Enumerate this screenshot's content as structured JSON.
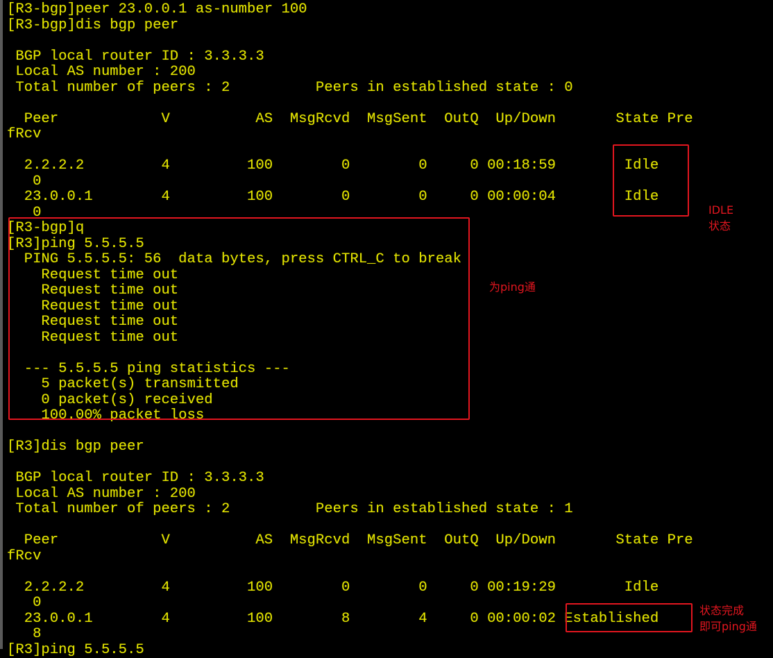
{
  "terminal": {
    "text_color": "#e1e100",
    "background": "#000000",
    "lines": [
      "[R3-bgp]",
      "[R3-bgp]peer 23.0.0.1 as-number 100",
      "[R3-bgp]dis bgp peer",
      "",
      " BGP local router ID : 3.3.3.3",
      " Local AS number : 200",
      " Total number of peers : 2          Peers in established state : 0",
      "",
      "  Peer            V          AS  MsgRcvd  MsgSent  OutQ  Up/Down       State Pre",
      "fRcv",
      "",
      "  2.2.2.2         4         100        0        0     0 00:18:59        Idle",
      "   0",
      "  23.0.0.1        4         100        0        0     0 00:00:04        Idle",
      "   0",
      "[R3-bgp]q",
      "[R3]ping 5.5.5.5",
      "  PING 5.5.5.5: 56  data bytes, press CTRL_C to break",
      "    Request time out",
      "    Request time out",
      "    Request time out",
      "    Request time out",
      "    Request time out",
      "",
      "  --- 5.5.5.5 ping statistics ---",
      "    5 packet(s) transmitted",
      "    0 packet(s) received",
      "    100.00% packet loss",
      "",
      "[R3]dis bgp peer",
      "",
      " BGP local router ID : 3.3.3.3",
      " Local AS number : 200",
      " Total number of peers : 2          Peers in established state : 1",
      "",
      "  Peer            V          AS  MsgRcvd  MsgSent  OutQ  Up/Down       State Pre",
      "fRcv",
      "",
      "  2.2.2.2         4         100        0        0     0 00:19:29        Idle",
      "   0",
      "  23.0.0.1        4         100        8        4     0 00:00:02 Established",
      "   8",
      "[R3]ping 5.5.5.5"
    ]
  },
  "bgp_tables": [
    {
      "router_id": "3.3.3.3",
      "local_as": "200",
      "total_peers": "2",
      "established_peers": "0",
      "columns": [
        "Peer",
        "V",
        "AS",
        "MsgRcvd",
        "MsgSent",
        "OutQ",
        "Up/Down",
        "State",
        "PrefRcv"
      ],
      "rows": [
        [
          "2.2.2.2",
          "4",
          "100",
          "0",
          "0",
          "0",
          "00:18:59",
          "Idle",
          "0"
        ],
        [
          "23.0.0.1",
          "4",
          "100",
          "0",
          "0",
          "0",
          "00:00:04",
          "Idle",
          "0"
        ]
      ]
    },
    {
      "router_id": "3.3.3.3",
      "local_as": "200",
      "total_peers": "2",
      "established_peers": "1",
      "columns": [
        "Peer",
        "V",
        "AS",
        "MsgRcvd",
        "MsgSent",
        "OutQ",
        "Up/Down",
        "State",
        "PrefRcv"
      ],
      "rows": [
        [
          "2.2.2.2",
          "4",
          "100",
          "0",
          "0",
          "0",
          "00:19:29",
          "Idle",
          "0"
        ],
        [
          "23.0.0.1",
          "4",
          "100",
          "8",
          "4",
          "0",
          "00:00:02",
          "Established",
          "8"
        ]
      ]
    }
  ],
  "annotations": {
    "color": "#e3161f",
    "idle_label_1": "IDLE",
    "idle_label_2": "状态",
    "ping_label": "为ping通",
    "established_label_1": "状态完成",
    "established_label_2": "即可ping通"
  }
}
